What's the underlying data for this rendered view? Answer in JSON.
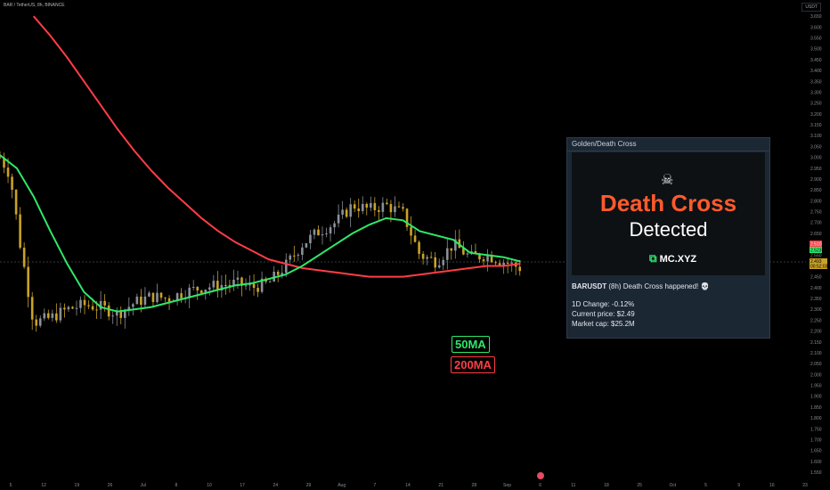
{
  "header": {
    "symbol": "BAR / TetherUS, 8h, BINANCE",
    "currency": "USDT"
  },
  "colors": {
    "ma50": "#2fe86a",
    "ma200": "#ff3d46",
    "candle_up": "#8a8f98",
    "candle_down": "#c9a227",
    "accent": "#ff5a2c"
  },
  "price_tags": {
    "ma50": "2.523",
    "ma200": "2.510",
    "last_price": "2.493",
    "countdown": "00:52:03"
  },
  "ma_labels": {
    "ma50": "50MA",
    "ma200": "200MA"
  },
  "card": {
    "header": "Golden/Death Cross",
    "image_title": "Death Cross",
    "image_subtitle": "Detected",
    "logo": "MC.XYZ",
    "icon": "skull-icon",
    "pair": "BARUSDT",
    "message": " (8h) Death Cross happened! 💀",
    "change": "1D Change: -0.12%",
    "price": "Current price: $2.49",
    "mcap": "Market cap: $25.2M"
  },
  "chart_data": {
    "type": "line",
    "x_ticks": [
      "5",
      "12",
      "19",
      "26",
      "Jul",
      "8",
      "10",
      "17",
      "24",
      "29",
      "Aug",
      "7",
      "14",
      "21",
      "28",
      "Sep",
      "6",
      "11",
      "18",
      "25",
      "Oct",
      "5",
      "9",
      "16",
      "23"
    ],
    "y_ticks": [
      "3.650",
      "3.600",
      "3.550",
      "3.500",
      "3.450",
      "3.400",
      "3.350",
      "3.300",
      "3.250",
      "3.200",
      "3.150",
      "3.100",
      "3.050",
      "3.000",
      "2.950",
      "2.900",
      "2.850",
      "2.800",
      "2.750",
      "2.700",
      "2.650",
      "2.600",
      "2.550",
      "2.500",
      "2.450",
      "2.400",
      "2.350",
      "2.300",
      "2.250",
      "2.200",
      "2.150",
      "2.100",
      "2.050",
      "2.000",
      "1.950",
      "1.900",
      "1.850",
      "1.800",
      "1.750",
      "1.700",
      "1.650",
      "1.600",
      "1.550"
    ],
    "ylim": [
      1.55,
      3.7
    ],
    "xlim": [
      0,
      24
    ],
    "series": [
      {
        "name": "50MA",
        "x": [
          0,
          0.5,
          1,
          1.5,
          2,
          2.5,
          3,
          3.5,
          4,
          4.5,
          5,
          5.5,
          6,
          6.5,
          7,
          7.5,
          8,
          8.5,
          9,
          9.5,
          10,
          10.5,
          11,
          11.5,
          12,
          12.5,
          13,
          13.5,
          14,
          14.5,
          15,
          15.5
        ],
        "y": [
          3.01,
          2.95,
          2.82,
          2.66,
          2.51,
          2.38,
          2.31,
          2.29,
          2.3,
          2.31,
          2.33,
          2.35,
          2.37,
          2.39,
          2.41,
          2.42,
          2.44,
          2.46,
          2.5,
          2.55,
          2.6,
          2.65,
          2.69,
          2.72,
          2.71,
          2.66,
          2.64,
          2.62,
          2.56,
          2.55,
          2.54,
          2.52
        ]
      },
      {
        "name": "200MA",
        "x": [
          1,
          1.5,
          2,
          2.5,
          3,
          3.5,
          4,
          4.5,
          5,
          5.5,
          6,
          6.5,
          7,
          7.5,
          8,
          8.5,
          9,
          9.5,
          10,
          10.5,
          11,
          11.5,
          12,
          12.5,
          13,
          13.5,
          14,
          14.5,
          15,
          15.5
        ],
        "y": [
          3.65,
          3.56,
          3.46,
          3.35,
          3.24,
          3.13,
          3.03,
          2.94,
          2.86,
          2.79,
          2.72,
          2.66,
          2.61,
          2.57,
          2.53,
          2.51,
          2.49,
          2.48,
          2.47,
          2.46,
          2.45,
          2.45,
          2.45,
          2.46,
          2.47,
          2.48,
          2.49,
          2.5,
          2.5,
          2.51
        ]
      },
      {
        "name": "price",
        "x": [
          0,
          0.3,
          0.6,
          1,
          1.5,
          2,
          2.5,
          3,
          3.5,
          4,
          4.5,
          5,
          5.5,
          6,
          6.5,
          7,
          7.5,
          8,
          8.5,
          9,
          9.5,
          10,
          10.5,
          11,
          11.5,
          12,
          12.5,
          13,
          13.5,
          14,
          14.5,
          15,
          15.5
        ],
        "y": [
          3.0,
          2.92,
          2.6,
          2.24,
          2.26,
          2.3,
          2.32,
          2.31,
          2.28,
          2.33,
          2.36,
          2.35,
          2.38,
          2.4,
          2.41,
          2.42,
          2.4,
          2.42,
          2.5,
          2.6,
          2.66,
          2.7,
          2.78,
          2.76,
          2.78,
          2.74,
          2.55,
          2.52,
          2.6,
          2.54,
          2.55,
          2.52,
          2.49
        ]
      }
    ]
  }
}
